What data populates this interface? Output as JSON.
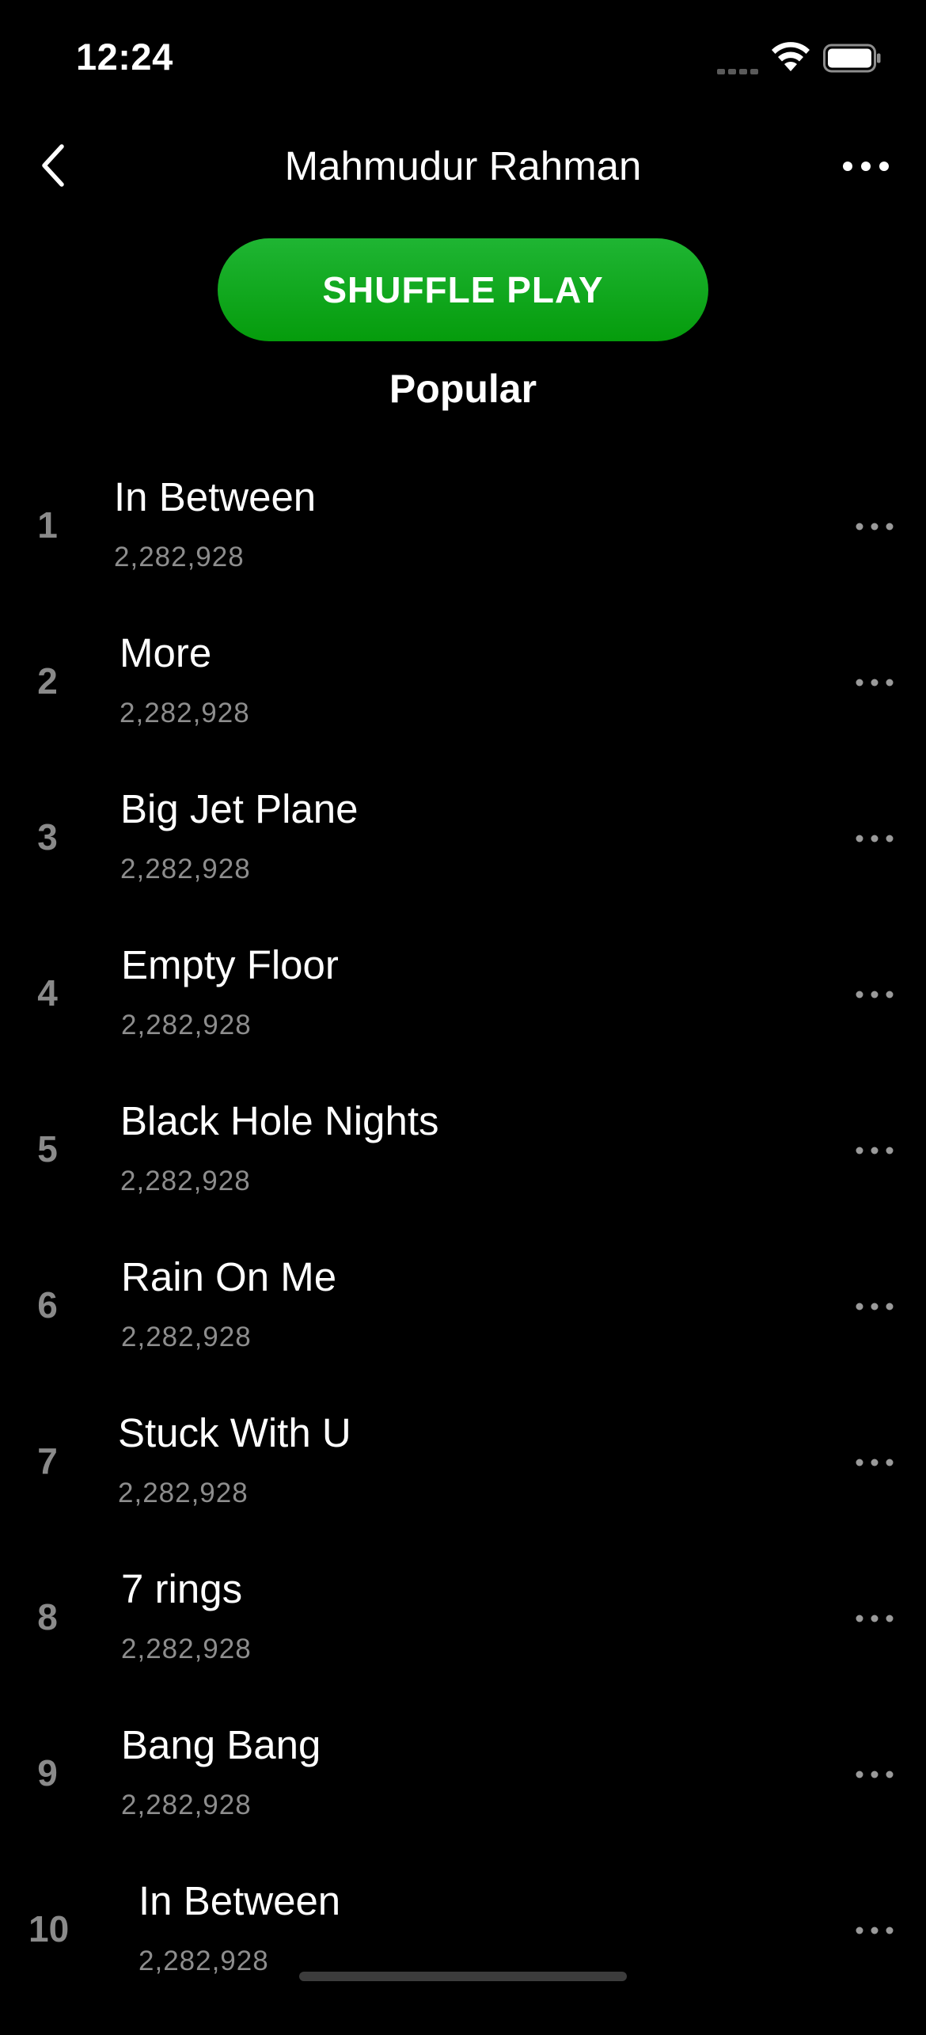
{
  "status_bar": {
    "time": "12:24"
  },
  "header": {
    "title": "Mahmudur Rahman",
    "back_icon": "chevron-left-icon",
    "more_icon": "ellipsis-icon"
  },
  "shuffle": {
    "label": "SHUFFLE PLAY",
    "color": "#0fa81f"
  },
  "section": {
    "title": "Popular"
  },
  "tracks": [
    {
      "number": "1",
      "title": "In Between",
      "plays": "2,282,928"
    },
    {
      "number": "2",
      "title": "More",
      "plays": "2,282,928"
    },
    {
      "number": "3",
      "title": "Big Jet Plane",
      "plays": "2,282,928"
    },
    {
      "number": "4",
      "title": "Empty Floor",
      "plays": "2,282,928"
    },
    {
      "number": "5",
      "title": "Black Hole Nights",
      "plays": "2,282,928"
    },
    {
      "number": "6",
      "title": "Rain On Me",
      "plays": "2,282,928"
    },
    {
      "number": "7",
      "title": "Stuck With U",
      "plays": "2,282,928"
    },
    {
      "number": "8",
      "title": "7 rings",
      "plays": "2,282,928"
    },
    {
      "number": "9",
      "title": "Bang Bang",
      "plays": "2,282,928"
    },
    {
      "number": "10",
      "title": "In Between",
      "plays": "2,282,928"
    }
  ]
}
